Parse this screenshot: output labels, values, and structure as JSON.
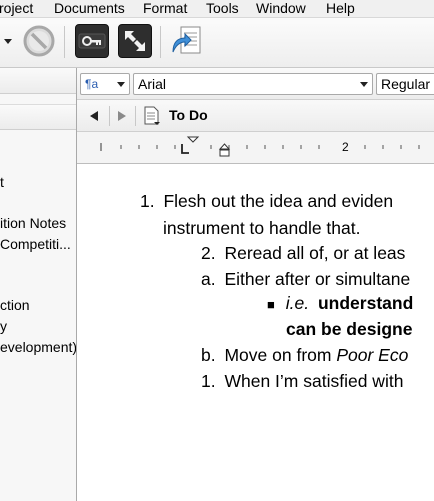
{
  "menu": {
    "items": [
      {
        "label": "roject"
      },
      {
        "label": "Documents"
      },
      {
        "label": "Format"
      },
      {
        "label": "Tools"
      },
      {
        "label": "Window"
      },
      {
        "label": "Help"
      }
    ]
  },
  "toolbar": {
    "buttons": [
      {
        "icon": "no-entry-icon"
      },
      {
        "icon": "keywords-icon"
      },
      {
        "icon": "fullscreen-icon"
      },
      {
        "icon": "scrivenings-icon"
      }
    ]
  },
  "binder": {
    "items": [
      {
        "label": "t"
      },
      {
        "label": "ition Notes"
      },
      {
        "label": "Competiti..."
      },
      {
        "label": "ction"
      },
      {
        "label": "y"
      },
      {
        "label": "evelopment)"
      }
    ]
  },
  "formatbar": {
    "style_icon": "¶a",
    "font": "Arial",
    "weight": "Regular"
  },
  "header": {
    "title": "To Do"
  },
  "ruler": {
    "mark": "2"
  },
  "editor": {
    "l1_num": "1.",
    "l1_text": "Flesh out the idea and eviden",
    "l2_text": "instrument to handle that.",
    "l3_num": "2.",
    "l3_text": "Reread all of, or at leas",
    "l4_num": "a.",
    "l4_text": "Either after or simultane",
    "l5_bullet": "■",
    "l5_italic": "i.e.",
    "l5_bold": "understand",
    "l6_bold": "can be designe",
    "l7_num": "b.",
    "l7_text": "Move on from ",
    "l7_italic": "Poor Eco",
    "l8_num": "1.",
    "l8_text": "When I’m satisfied with"
  }
}
